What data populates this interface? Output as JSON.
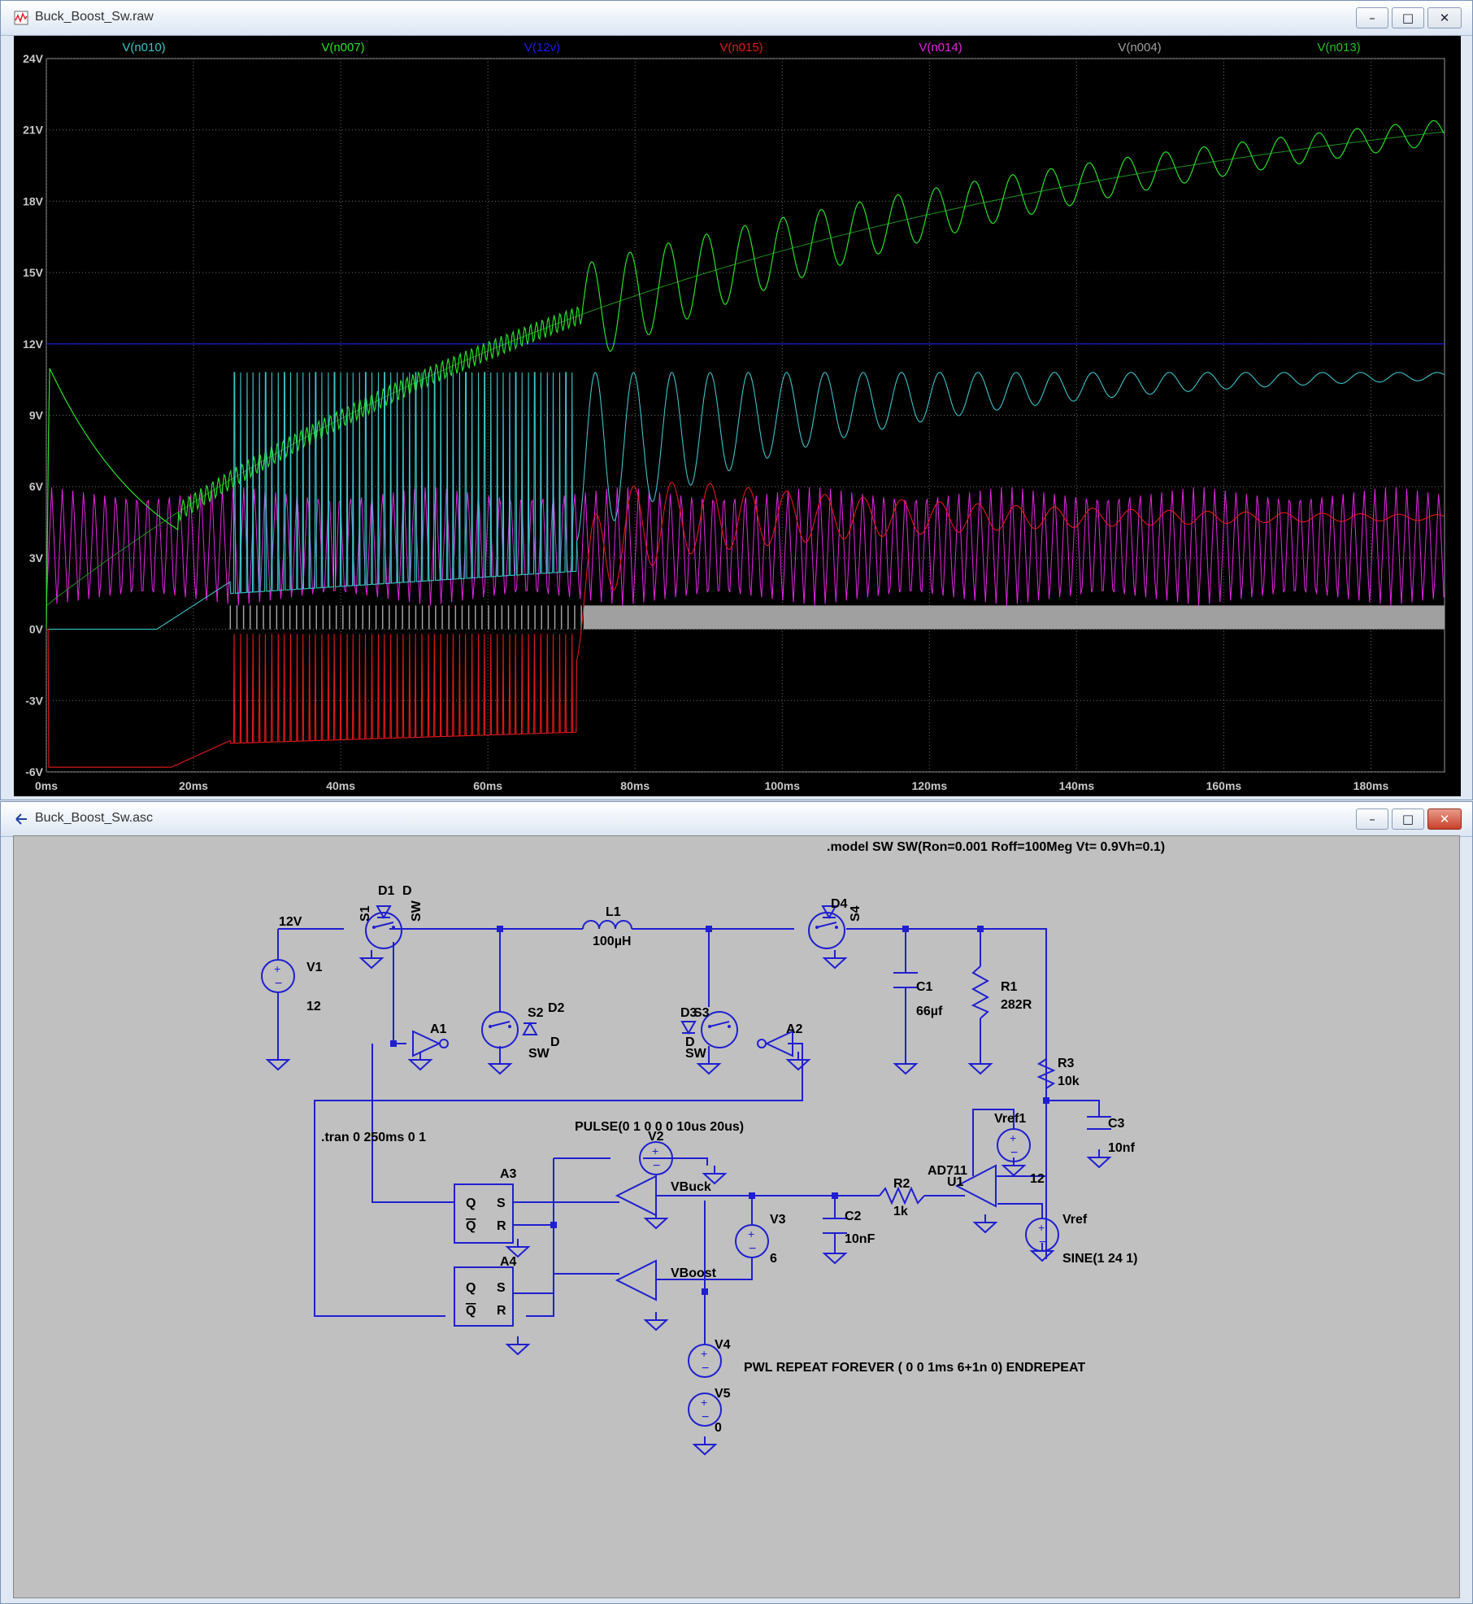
{
  "waveform_window": {
    "title": "Buck_Boost_Sw.raw",
    "buttons": {
      "minimize": "–",
      "restore": "□",
      "close": "✕"
    }
  },
  "schematic_window": {
    "title": "Buck_Boost_Sw.asc",
    "buttons": {
      "minimize": "–",
      "restore": "□",
      "close": "✕"
    }
  },
  "colors": {
    "n010": "#3cc3c8",
    "n007": "#28e028",
    "12v": "#1c1ce6",
    "n015": "#e41a1a",
    "n014": "#e626e6",
    "n004": "#a0a0a0",
    "n013": "#1f8f1f",
    "wire": "#1f1fd0",
    "schem_bg": "#c0c0c0"
  },
  "chart_data": {
    "type": "line",
    "xlabel": "",
    "ylabel": "",
    "xlim": [
      0,
      190
    ],
    "ylim": [
      -6,
      24
    ],
    "x_ticks": [
      "0ms",
      "20ms",
      "40ms",
      "60ms",
      "80ms",
      "100ms",
      "120ms",
      "140ms",
      "160ms",
      "180ms"
    ],
    "y_ticks": [
      "24V",
      "21V",
      "18V",
      "15V",
      "12V",
      "9V",
      "6V",
      "3V",
      "0V",
      "-3V",
      "-6V"
    ],
    "grid": true,
    "legend_position": "top",
    "series": [
      {
        "name": "V(n010)",
        "color_key": "n010",
        "x": [
          0,
          25,
          25.5,
          72,
          75,
          80,
          90,
          100,
          110,
          120,
          130,
          140,
          150,
          160,
          170,
          190
        ],
        "y": [
          0,
          0,
          10.5,
          10.5,
          9.5,
          6,
          6.5,
          7,
          7.5,
          8,
          8.5,
          9.2,
          9.8,
          10.3,
          10.6,
          10.8
        ]
      },
      {
        "name": "V(n007)",
        "color_key": "n007",
        "x": [
          0,
          0.5,
          10,
          18,
          25,
          40,
          60,
          80,
          100,
          120,
          140,
          160,
          180,
          190
        ],
        "y": [
          0,
          11,
          8,
          4,
          5,
          7.5,
          10.8,
          14,
          16.5,
          18.3,
          20,
          21.3,
          22.5,
          23.2
        ]
      },
      {
        "name": "V(12v)",
        "color_key": "12v",
        "x": [
          0,
          190
        ],
        "y": [
          12,
          12
        ]
      },
      {
        "name": "V(n015)",
        "color_key": "n015",
        "x": [
          0,
          16,
          20,
          25,
          30,
          50,
          72,
          80,
          100,
          140,
          190
        ],
        "y": [
          -5.8,
          -5.8,
          -5,
          -4.8,
          -4.5,
          -4.5,
          -4.5,
          3.5,
          4,
          4.6,
          4.7
        ]
      },
      {
        "name": "V(n014)",
        "color_key": "n014",
        "x": [
          0,
          190
        ],
        "y": [
          1,
          6
        ]
      },
      {
        "name": "V(n004)",
        "color_key": "n004",
        "x": [
          0,
          25,
          190
        ],
        "y": [
          0,
          0,
          1
        ]
      },
      {
        "name": "V(n013)",
        "color_key": "n013",
        "x": [
          0,
          20,
          40,
          60,
          80,
          100,
          120,
          140,
          160,
          180,
          190
        ],
        "y": [
          1,
          4,
          7.5,
          10.8,
          14,
          16.5,
          18.3,
          20,
          21.3,
          22.5,
          23.2
        ]
      }
    ]
  },
  "schematic": {
    "model_directive": ".model SW SW(Ron=0.001 Roff=100Meg Vt= 0.9Vh=0.1)",
    "tran_directive": ".tran 0 250ms 0 1",
    "pulse_text": "PULSE(0 1 0 0 0 10us 20us)",
    "pwl_text": "PWL REPEAT FOREVER ( 0 0 1ms 6+1n 0) ENDREPEAT",
    "net_12v": "12V",
    "vbuck": "VBuck",
    "vboost": "VBoost",
    "components": {
      "d1": "D1",
      "d1_model": "D",
      "s1": "S1",
      "s1_model": "SW",
      "d4": "D4",
      "d4_model": "D",
      "s4": "S4",
      "s4_model": "SW",
      "l1": "L1",
      "l1_val": "100µH",
      "v1": "V1",
      "v1_val": "12",
      "s2": "S2",
      "d2": "D2",
      "d2_model": "D",
      "s2_model": "SW",
      "d3": "D3",
      "s3": "S3",
      "d3_model": "D",
      "s3_model": "SW",
      "a1": "A1",
      "a2": "A2",
      "a3": "A3",
      "a4": "A4",
      "c1": "C1",
      "c1_val": "66µf",
      "r1": "R1",
      "r1_val": "282R",
      "r3": "R3",
      "r3_val": "10k",
      "c3": "C3",
      "c3_val": "10nf",
      "vref1": "Vref1",
      "vref1_val": "12",
      "v2": "V2",
      "u1": "U1",
      "u1_model": "AD711",
      "r2": "R2",
      "r2_val": "1k",
      "c2": "C2",
      "c2_val": "10nF",
      "v3": "V3",
      "v3_val": "6",
      "vref": "Vref",
      "vref_val": "SINE(1 24 1)",
      "v4": "V4",
      "v5": "V5",
      "v5_val": "0",
      "pin_q": "Q",
      "pin_qb": "Q",
      "pin_s": "S",
      "pin_r": "R"
    }
  }
}
